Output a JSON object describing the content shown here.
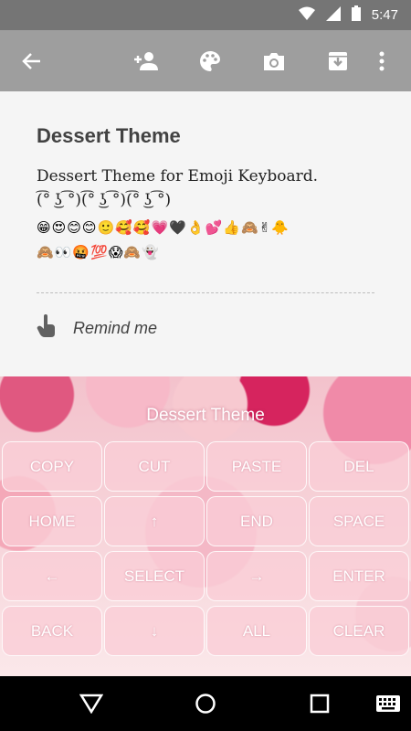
{
  "status_bar": {
    "time": "5:47"
  },
  "toolbar": {
    "icons": [
      "back-arrow-icon",
      "add-person-icon",
      "palette-icon",
      "camera-icon",
      "archive-icon",
      "more-vert-icon"
    ]
  },
  "note": {
    "title": "Dessert Theme",
    "body_line1": "Dessert Theme for Emoji Keyboard.",
    "body_line2": "(͡° ͜ʖ ͡°)(͡° ͜ʖ ͡°)(͡° ͜ʖ ͡°)",
    "emoji_line1": "😁😍😊😊🙂🥰🥰💗🖤👌💕👍🙈✌🐥",
    "emoji_line2": "🙈👀🤬💯😱🙈👻",
    "reminder_label": "Remind me"
  },
  "keyboard": {
    "title": "Dessert Theme",
    "keys": [
      [
        "COPY",
        "CUT",
        "PASTE",
        "DEL"
      ],
      [
        "HOME",
        "↑",
        "END",
        "SPACE"
      ],
      [
        "←",
        "SELECT",
        "→",
        "ENTER"
      ],
      [
        "BACK",
        "↓",
        "ALL",
        "CLEAR"
      ]
    ]
  }
}
